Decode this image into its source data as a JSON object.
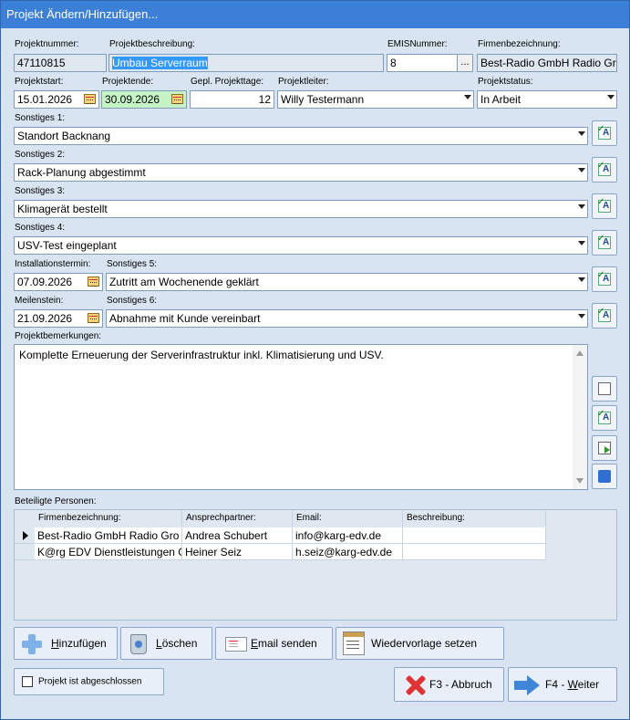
{
  "window": {
    "title": "Projekt Ändern/Hinzufügen..."
  },
  "labels": {
    "projektnummer": "Projektnummer:",
    "projektbeschreibung": "Projektbeschreibung:",
    "emisnummer": "EMISNummer:",
    "firmenbezeichnung": "Firmenbezeichnung:",
    "projektstart": "Projektstart:",
    "projektende": "Projektende:",
    "projekttage": "Gepl. Projekttage:",
    "projektleiter": "Projektleiter:",
    "projektstatus": "Projektstatus:",
    "sonstiges1": "Sonstiges 1:",
    "sonstiges2": "Sonstiges 2:",
    "sonstiges3": "Sonstiges 3:",
    "sonstiges4": "Sonstiges 4:",
    "installationstermin": "Installationstermin:",
    "sonstiges5": "Sonstiges 5:",
    "meilenstein": "Meilenstein:",
    "sonstiges6": "Sonstiges 6:",
    "projektbemerkungen": "Projektbemerkungen:",
    "beteiligte": "Beteiligte Personen:"
  },
  "values": {
    "projektnummer": "47110815",
    "projektbeschreibung": "Umbau Serverraum",
    "emisnummer": "8",
    "emis_button": "...",
    "firmenbezeichnung": "Best-Radio GmbH Radio Gro",
    "projektstart": "15.01.2026",
    "projektende": "30.09.2026",
    "projekttage": "12",
    "projektleiter": "Willy Testermann",
    "projektstatus": "In Arbeit",
    "sonstiges1": "Standort Backnang",
    "sonstiges2": "Rack-Planung abgestimmt",
    "sonstiges3": "Klimagerät bestellt",
    "sonstiges4": "USV-Test eingeplant",
    "installationstermin": "07.09.2026",
    "sonstiges5": "Zutritt am Wochenende geklärt",
    "meilenstein": "21.09.2026",
    "sonstiges6": "Abnahme mit Kunde vereinbart",
    "projektbemerkungen": "Komplette Erneuerung der Serverinfrastruktur inkl. Klimatisierung und USV."
  },
  "grid": {
    "columns": [
      "Firmenbezeichnung:",
      "Ansprechpartner:",
      "Email:",
      "Beschreibung:"
    ],
    "rows": [
      [
        "Best-Radio GmbH Radio Gro",
        "Andrea Schubert",
        "info@karg-edv.de",
        ""
      ],
      [
        "K@rg EDV Dienstleistungen G",
        "Heiner Seiz",
        "h.seiz@karg-edv.de",
        ""
      ]
    ]
  },
  "buttons": {
    "hinzufuegen": {
      "u": "H",
      "rest": "inzufügen"
    },
    "loeschen": {
      "u": "L",
      "rest": "öschen"
    },
    "email": {
      "u": "E",
      "rest": "mail senden"
    },
    "wiedervorlage": "Wiedervorlage setzen",
    "abbruch": "F3 - Abbruch",
    "weiter": {
      "pre": "F4 - ",
      "u": "W",
      "rest": "eiter"
    }
  },
  "checkbox": {
    "abgeschlossen": "Projekt ist abgeschlossen",
    "checked": false
  },
  "icons": {
    "edit": "edit-text-icon",
    "copy": "copy-icon",
    "export": "export-icon",
    "word": "word-doc-icon"
  },
  "colors": {
    "title_bar": "#3c7fd6",
    "window_bg": "#d9e4f2",
    "selection": "#3399ff",
    "date_highlight": "#c6f3c6"
  }
}
